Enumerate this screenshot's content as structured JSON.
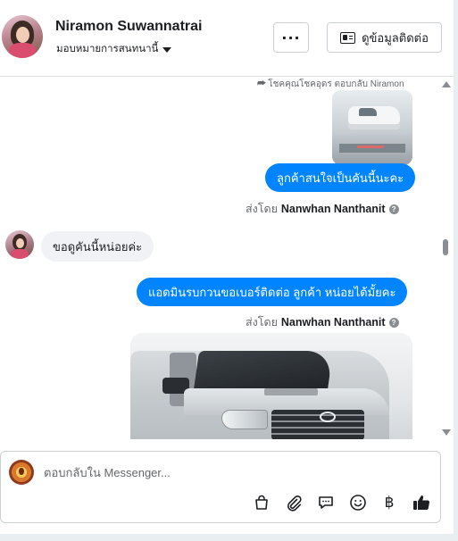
{
  "header": {
    "contact_name": "Niramon Suwannatrai",
    "assign_label": "มอบหมายการสนทนานี้",
    "more_label": "···",
    "contact_info_label": "ดูข้อมูลติดต่อ"
  },
  "chat": {
    "reply_note": "โชคคุณโชคอุดร ตอบกลับ Niramon",
    "messages": [
      {
        "direction": "out",
        "text": "ลูกค้าสนใจเป็นคันนี้นะคะ"
      },
      {
        "direction": "in",
        "text": "ขอดูคันนี้หน่อยค่ะ"
      },
      {
        "direction": "out",
        "text": "แอดมินรบกวนขอเบอร์ติดต่อ ลูกค้า  หน่อยได้มั้ยคะ"
      }
    ],
    "sent_by_prefix": "ส่งโดย",
    "sent_by_name": "Nanwhan Nanthanit",
    "help_mark": "?"
  },
  "composer": {
    "placeholder": "ตอบกลับใน Messenger...",
    "tools": [
      "shopping-bag-icon",
      "paperclip-icon",
      "chat-bubble-icon",
      "emoji-icon",
      "baht-icon",
      "thumbs-up-icon"
    ],
    "baht_glyph": "฿"
  },
  "colors": {
    "accent": "#0084ff",
    "incoming_bubble": "#f0f2f5",
    "muted_text": "#65676b"
  }
}
